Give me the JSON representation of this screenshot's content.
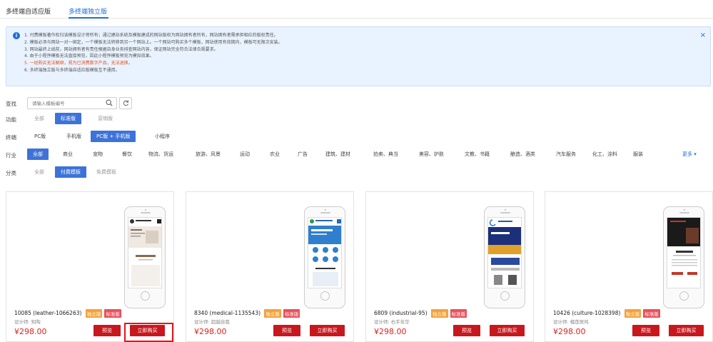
{
  "tabs": [
    "多终端自适应版",
    "多终端独立版"
  ],
  "notice": {
    "lines": [
      "1. 付费模板著作权归该模板设计师所有；通过建站系统及模板建成的网站版权为网站拥有者所有，网站拥有者需承担相应的版权责任。",
      "2. 模板必须与网站一对一绑定，一个模板无法转移到另一个网站上。一个网站可购买多个模板，网站使用有效期内，模板可无限次安装。",
      "3. 网站最终上线前，网站拥有者有责任根据自身业务排查网站内容，保证网站完全符合法律合规要求。",
      "4. 由于小程序模板无法直接预览，因此小程序模板预览为模拟效果。",
      "5. 一经购买无法解绑，视为已消费数字产品，无法退换。",
      "6. 多终端独立版与多终端自适应版模板互不通用。"
    ],
    "close": "×"
  },
  "search": {
    "label": "查找",
    "placeholder": "请输入模板编号"
  },
  "filters": {
    "function": {
      "label": "功能",
      "options": [
        "全部",
        "标准版",
        "营销版"
      ]
    },
    "terminal": {
      "label": "终端",
      "options": [
        "PC版",
        "手机版",
        "PC版 + 手机版",
        "小程序"
      ]
    },
    "industry": {
      "label": "行业",
      "options": [
        "全部",
        "商业",
        "宠物",
        "餐饮",
        "物流、货运",
        "旅游、风景",
        "运动",
        "农业",
        "广告",
        "建筑、建材",
        "拍卖、典当",
        "美容、护肤",
        "文教、书籍",
        "酿造、酒类",
        "汽车服务",
        "化工、涂料",
        "服装"
      ],
      "more": "更多 ▾"
    },
    "category": {
      "label": "分类",
      "options": [
        "全部",
        "付费模板",
        "免费模板"
      ]
    }
  },
  "cards": [
    {
      "id": "10085",
      "code": "(leather-1066263)",
      "badge1": "独立版",
      "badge2": "标准版",
      "designer": "设计师: 知陶",
      "price": "¥298.00",
      "preview": "预览",
      "buy": "立即购买"
    },
    {
      "id": "8340",
      "code": "(medical-1135543)",
      "badge1": "独立版",
      "badge2": "标准版",
      "designer": "设计师: 超越自我",
      "price": "¥298.00",
      "preview": "预览",
      "buy": "立即购买"
    },
    {
      "id": "6809",
      "code": "(industrial-95)",
      "badge1": "独立版",
      "badge2": "标准版",
      "designer": "设计师: 右手年华",
      "price": "¥298.00",
      "preview": "预览",
      "buy": "立即购买"
    },
    {
      "id": "10426",
      "code": "(culture-1028398)",
      "badge1": "独立版",
      "badge2": "标准版",
      "designer": "设计师: 榴莲斑鸠",
      "price": "¥298.00",
      "preview": "预览",
      "buy": "立即购买"
    }
  ],
  "colors": {
    "accent": "#3d73d9",
    "buy_red": "#c9171e",
    "price_red": "#d9241e"
  }
}
